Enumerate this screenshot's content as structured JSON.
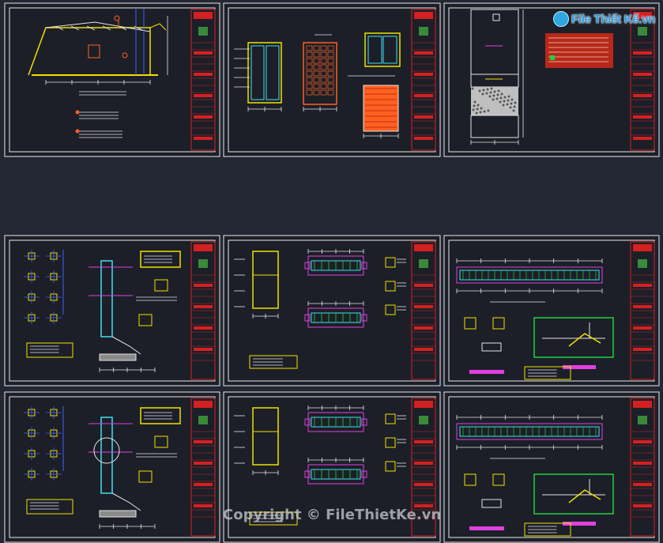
{
  "watermark": {
    "logo_text": "File Thiết Kế",
    "logo_suffix": ".vn",
    "copyright": "Copyright © FileThietKe.vn"
  },
  "colors": {
    "background": "#232733",
    "sheet_bg": "#1c1f28",
    "sheet_border": "#e8e8e8",
    "title_block": "#d42020",
    "cad_yellow": "#f0e000",
    "cad_cyan": "#40e0f0",
    "cad_magenta": "#e040e0",
    "cad_green": "#20d040",
    "cad_white": "#e6e6e6",
    "cad_blue": "#4060ff",
    "cad_orange": "#ff6020"
  }
}
